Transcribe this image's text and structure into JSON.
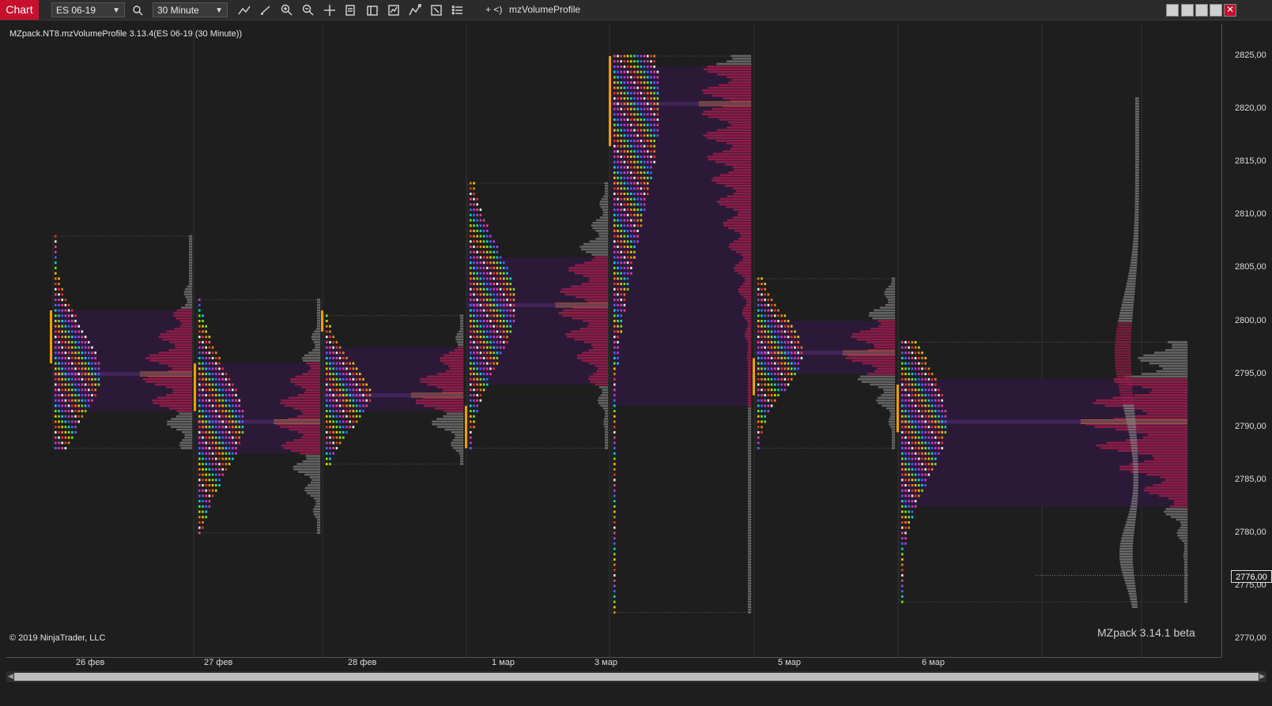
{
  "app": {
    "tab_label": "Chart"
  },
  "toolbar": {
    "instrument": "ES 06-19",
    "interval": "30 Minute",
    "plus_label": "+ <)",
    "indicator_name": "mzVolumeProfile",
    "icons": [
      "search-icon",
      "line-tool-icon",
      "pencil-icon",
      "zoom-in-icon",
      "zoom-out-icon",
      "crosshair-icon",
      "properties-icon",
      "data-box-icon",
      "strategies-icon",
      "indicators-icon",
      "templates-icon",
      "list-icon"
    ]
  },
  "window_controls": {
    "close_glyph": "✕"
  },
  "chart": {
    "title": "MZpack.NT8.mzVolumeProfile 3.13.4(ES 06-19 (30 Minute))",
    "copyright": "© 2019 NinjaTrader, LLC",
    "watermark": "MZpack 3.14.1 beta",
    "current_price": "2776,00",
    "price_labels": [
      "2825,00",
      "2820,00",
      "2815,00",
      "2810,00",
      "2805,00",
      "2800,00",
      "2795,00",
      "2790,00",
      "2785,00",
      "2780,00",
      "2775,00",
      "2770,00"
    ],
    "date_labels": [
      "26 фев",
      "27 фев",
      "28 фев",
      "1 мар",
      "3 мар",
      "5 мар",
      "6 мар"
    ],
    "colors": {
      "background": "#1e1e1e",
      "value_area": "#2c1a3a",
      "poc": "#c8781e",
      "ib": "#f0a000",
      "profile": "#a01e4a",
      "profile_light": "#8a8a8a"
    }
  },
  "chart_data": {
    "type": "table",
    "ylim": [
      2769,
      2827
    ],
    "profiles": [
      {
        "date": "26 фев",
        "high": 2808,
        "low": 2788,
        "poc": 2795,
        "vah": 2801,
        "val": 2791.5,
        "ib_high": 2801,
        "ib_low": 2796
      },
      {
        "date": "27 фев",
        "high": 2802,
        "low": 2780,
        "poc": 2790.5,
        "vah": 2796,
        "val": 2787.5,
        "ib_high": 2796,
        "ib_low": 2791.5
      },
      {
        "date": "28 фев",
        "high": 2800.5,
        "low": 2786.5,
        "poc": 2793,
        "vah": 2797.5,
        "val": 2791.5,
        "ib_high": 2801,
        "ib_low": 2799
      },
      {
        "date": "1 мар",
        "high": 2813,
        "low": 2788,
        "poc": 2801.5,
        "vah": 2806,
        "val": 2794,
        "ib_high": 2792,
        "ib_low": 2788
      },
      {
        "date": "3 мар",
        "high": 2825,
        "low": 2772.5,
        "poc": 2820.5,
        "vah": 2824,
        "val": 2792,
        "ib_high": 2825,
        "ib_low": 2816.5
      },
      {
        "date": "5 мар",
        "high": 2804,
        "low": 2788,
        "poc": 2797,
        "vah": 2800,
        "val": 2795,
        "ib_high": 2796.5,
        "ib_low": 2793
      },
      {
        "date": "6 мар",
        "high": 2798,
        "low": 2773.5,
        "poc": 2790.5,
        "vah": 2794.5,
        "val": 2782.5,
        "ib_high": 2794,
        "ib_low": 2789.5
      }
    ]
  }
}
